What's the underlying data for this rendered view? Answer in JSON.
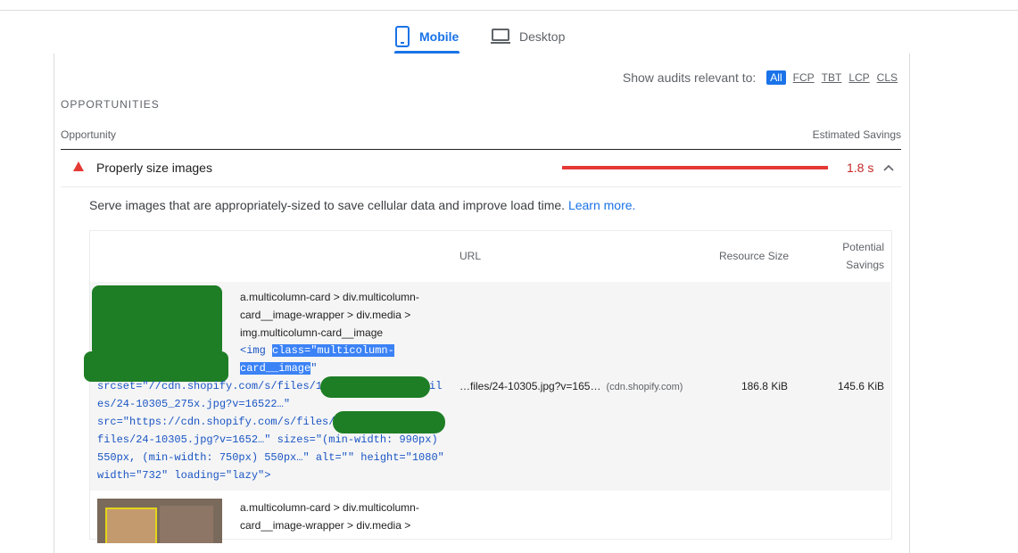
{
  "tabs": {
    "mobile": "Mobile",
    "desktop": "Desktop",
    "active": "mobile"
  },
  "filter": {
    "label": "Show audits relevant to:",
    "chips": [
      "All",
      "FCP",
      "TBT",
      "LCP",
      "CLS"
    ],
    "active": "All"
  },
  "section": {
    "title": "OPPORTUNITIES",
    "col_opportunity": "Opportunity",
    "col_savings": "Estimated Savings"
  },
  "opportunity": {
    "title": "Properly size images",
    "savings": "1.8 s",
    "severity_color": "#e53935",
    "bar_fraction": 1.0,
    "description": "Serve images that are appropriately-sized to save cellular data and improve load time.",
    "learn_more": "Learn more."
  },
  "table": {
    "headers": {
      "url": "URL",
      "resource_size": "Resource Size",
      "potential_line1": "Potential",
      "potential_line2": "Savings"
    },
    "rows": [
      {
        "node_path_1": "a.multicolumn-card > div.multicolumn-",
        "node_path_2": "card__image-wrapper > div.media >",
        "node_path_3": "img.multicolumn-card__image",
        "snippet_1a": "<img ",
        "snippet_1b": "class=\"multicolumn-",
        "snippet_2a": "card__image",
        "snippet_2b": "\"",
        "snippet_3a": "srcset=\"//cdn.shopify.com/s/files/1",
        "snippet_3b": "il",
        "snippet_4": "es/24-10305_275x.jpg?v=16522…\"",
        "snippet_5": "src=\"https://cdn.shopify.com/s/files/",
        "snippet_6": "files/24-10305.jpg?v=1652…\" sizes=\"(min-width: 990px)",
        "snippet_7": "550px, (min-width: 750px) 550px…\" alt=\"\" height=\"1080\"",
        "snippet_8": "width=\"732\" loading=\"lazy\">",
        "url": "…files/24-10305.jpg?v=165…",
        "host": "(cdn.shopify.com)",
        "resource_size": "186.8 KiB",
        "potential_savings": "145.6 KiB"
      },
      {
        "node_path_1": "a.multicolumn-card > div.multicolumn-",
        "node_path_2": "card__image-wrapper > div.media >"
      }
    ]
  }
}
